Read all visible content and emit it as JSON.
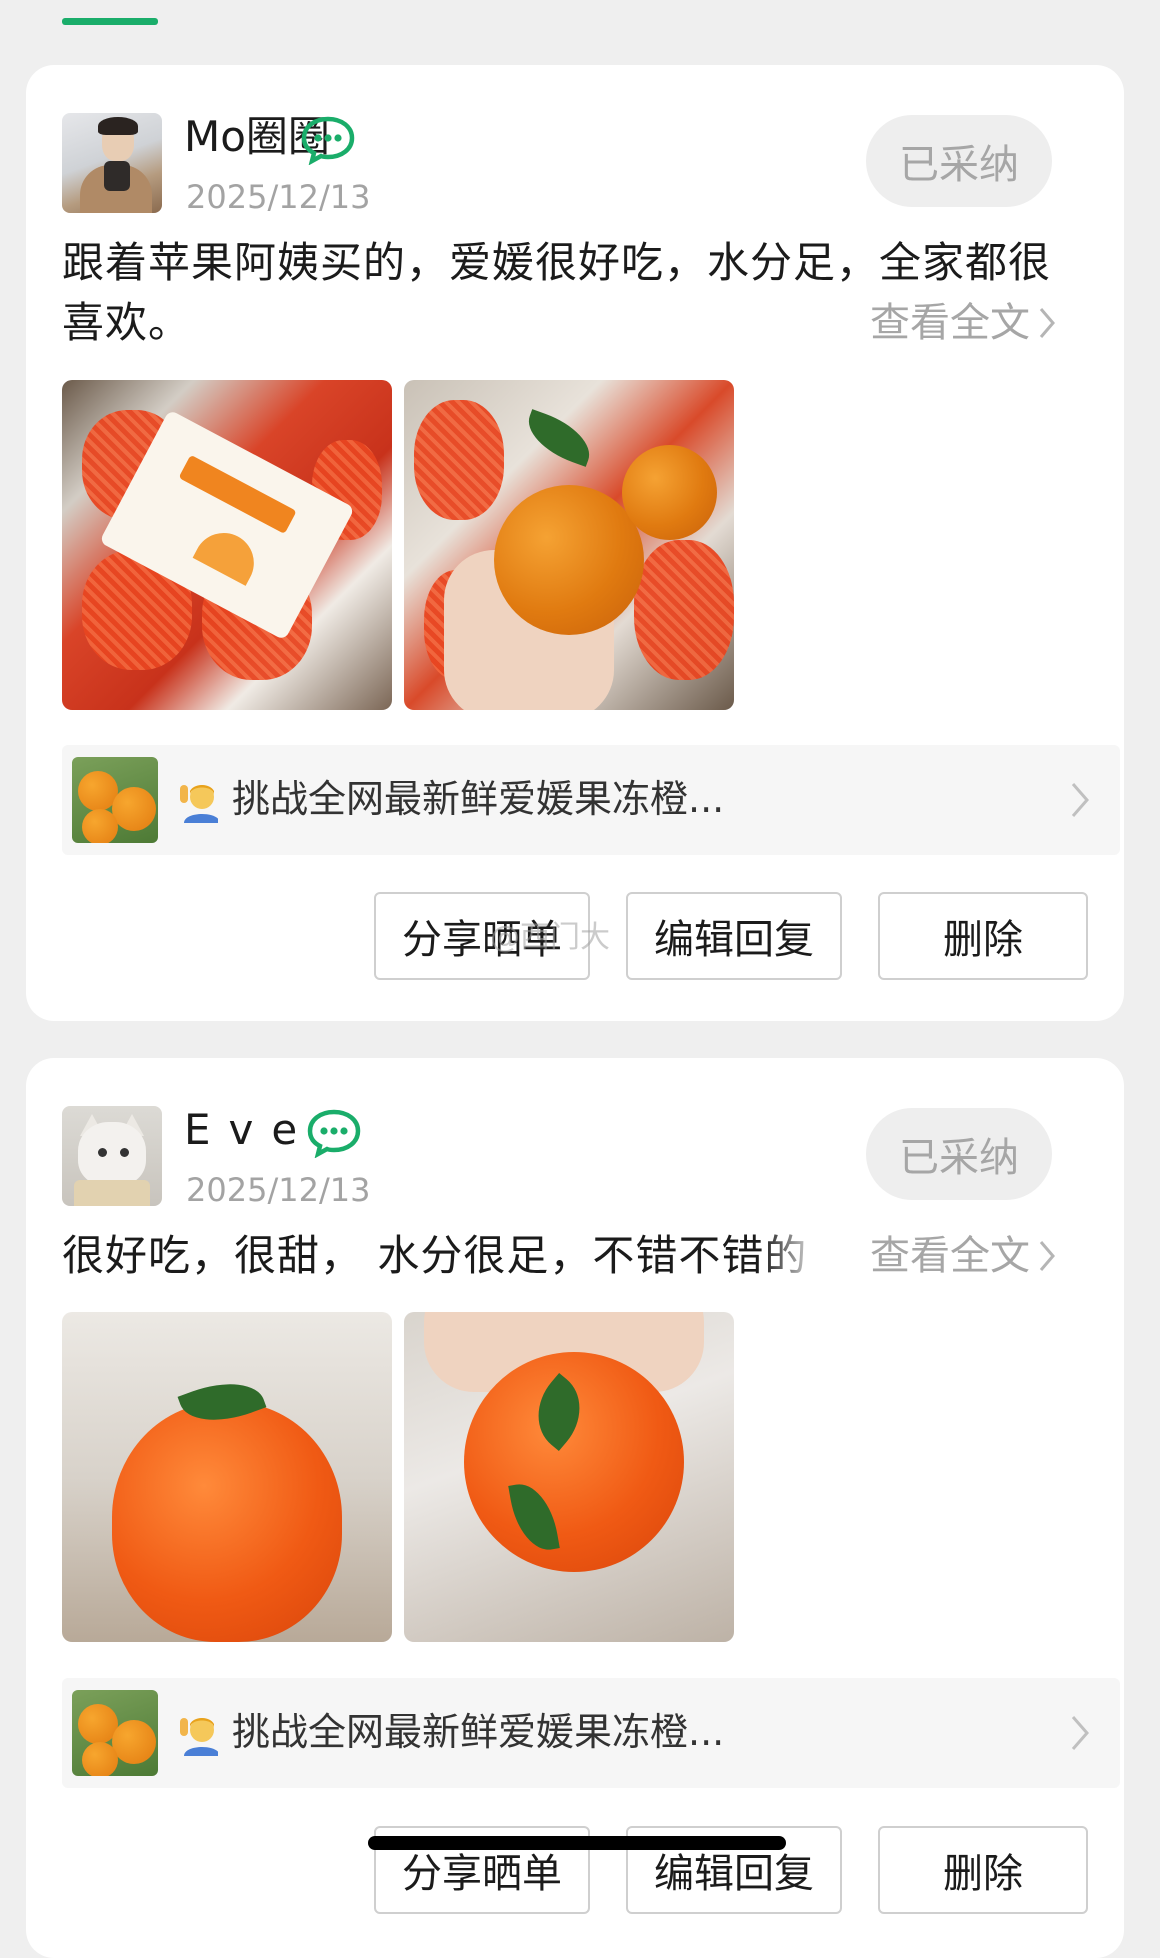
{
  "reviews": [
    {
      "username": "Mo圈圈",
      "date": "2025/12/13",
      "adopted_label": "已采纳",
      "text": "跟着苹果阿姨买的，爱媛很好吃，水分足，全家都很喜欢。",
      "view_full": "查看全文",
      "product_title": "挑战全网最新鲜爱媛果冻橙...",
      "buttons": {
        "share": "分享晒单",
        "edit": "编辑回复",
        "delete": "删除"
      }
    },
    {
      "username": "Eve",
      "date": "2025/12/13",
      "adopted_label": "已采纳",
      "text": "很好吃，很甜， 水分很足，不错不错的",
      "view_full": "查看全文",
      "product_title": "挑战全网最新鲜爱媛果冻橙...",
      "buttons": {
        "share": "分享晒单",
        "edit": "编辑回复",
        "delete": "删除"
      }
    }
  ],
  "watermark": "@西门大",
  "colors": {
    "accent": "#1aad6a",
    "muted": "#a6a6a6",
    "card": "#ffffff",
    "bg": "#efefef"
  },
  "icons": {
    "chat": "wechat-chat-icon",
    "chevron": "chevron-right-icon",
    "emoji": "person-raising-hand-emoji"
  }
}
